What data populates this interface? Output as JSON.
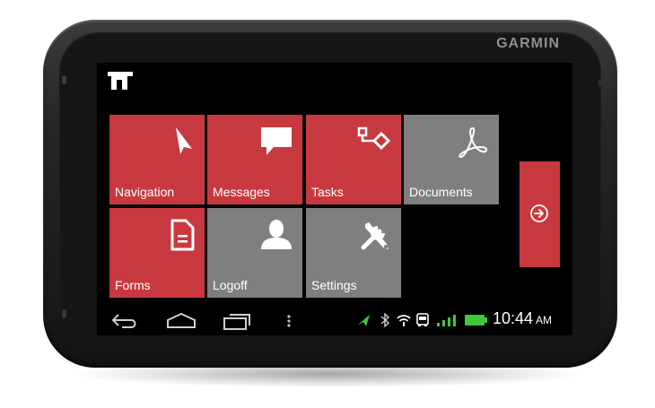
{
  "device": {
    "brand": "GARMIN"
  },
  "tiles": [
    {
      "label": "Navigation",
      "icon": "navigation-arrow-icon",
      "color": "#c8393f"
    },
    {
      "label": "Messages",
      "icon": "chat-bubble-icon",
      "color": "#c8393f"
    },
    {
      "label": "Tasks",
      "icon": "workflow-icon",
      "color": "#c8393f"
    },
    {
      "label": "Documents",
      "icon": "pdf-icon",
      "color": "#7f7f7f"
    },
    {
      "label": "Forms",
      "icon": "document-icon",
      "color": "#c8393f"
    },
    {
      "label": "Logoff",
      "icon": "user-icon",
      "color": "#7f7f7f"
    },
    {
      "label": "Settings",
      "icon": "tools-icon",
      "color": "#7f7f7f"
    }
  ],
  "next_button": {
    "icon": "arrow-circle-right-icon"
  },
  "status_bar": {
    "nav_icons": [
      "back-icon",
      "home-icon",
      "recent-apps-icon",
      "menu-dots-icon"
    ],
    "indicators": [
      "gps-arrow-icon",
      "bluetooth-icon",
      "wifi-icon",
      "bus-icon",
      "signal-bars-icon",
      "battery-icon"
    ],
    "time": "10:44",
    "ampm": "AM"
  },
  "colors": {
    "accent_red": "#c8393f",
    "tile_gray": "#7f7f7f",
    "status_green": "#3ec83a"
  }
}
